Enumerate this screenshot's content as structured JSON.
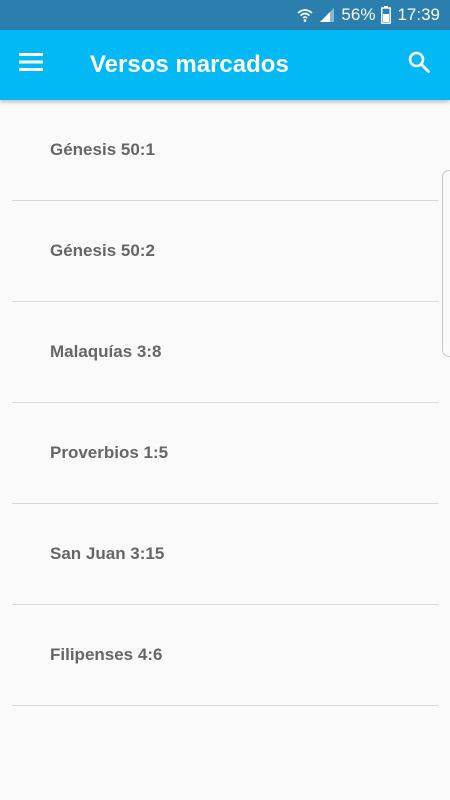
{
  "status_bar": {
    "battery": "56%",
    "time": "17:39"
  },
  "app_bar": {
    "title": "Versos marcados",
    "menu_icon": "hamburger-menu-icon",
    "search_icon": "search-icon"
  },
  "verses": [
    {
      "label": "Génesis 50:1"
    },
    {
      "label": "Génesis 50:2"
    },
    {
      "label": "Malaquías 3:8"
    },
    {
      "label": "Proverbios 1:5"
    },
    {
      "label": "San Juan 3:15"
    },
    {
      "label": "Filipenses 4:6"
    }
  ],
  "colors": {
    "status_bar": "#2a7fae",
    "app_bar": "#02b8f5",
    "background": "#fafafa",
    "label": "#666666",
    "divider": "#d8d8d8"
  }
}
